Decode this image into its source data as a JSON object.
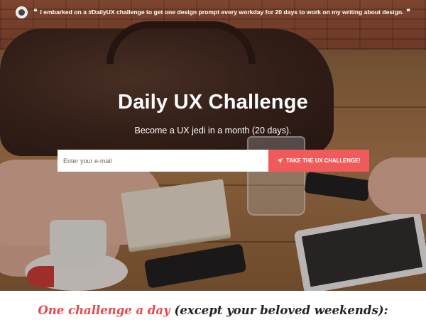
{
  "quote": {
    "open_mark": "❝",
    "text": "I embarked on a #DailyUX challenge to get one design prompt every workday for 20 days to work on my writing about design.",
    "close_mark": "❞"
  },
  "hero": {
    "title": "Daily UX Challenge",
    "subtitle": "Become a UX jedi in a month (20 days)."
  },
  "signup": {
    "email_placeholder": "Enter your e-mail",
    "email_value": "",
    "button_label": "TAKE THE UX CHALLENGE!",
    "button_icon": "paper-plane-icon"
  },
  "bottom": {
    "accent_text": "One challenge a day",
    "rest_text": " (except your beloved weekends):"
  },
  "colors": {
    "accent": "#f15a5a",
    "accent_text": "#e5484d"
  }
}
